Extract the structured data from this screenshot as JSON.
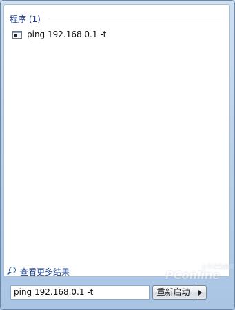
{
  "results": {
    "group_title": "程序 (1)",
    "items": [
      {
        "label": "ping 192.168.0.1 -t",
        "icon": "command-prompt-icon"
      }
    ]
  },
  "see_more": {
    "label": "查看更多结果",
    "icon": "search-icon"
  },
  "search": {
    "value": "ping 192.168.0.1 -t"
  },
  "power": {
    "button_label": "重新启动",
    "arrow_icon": "right-arrow-icon"
  },
  "watermark": {
    "text": "PConline",
    "sub": "太平洋电脑网"
  }
}
